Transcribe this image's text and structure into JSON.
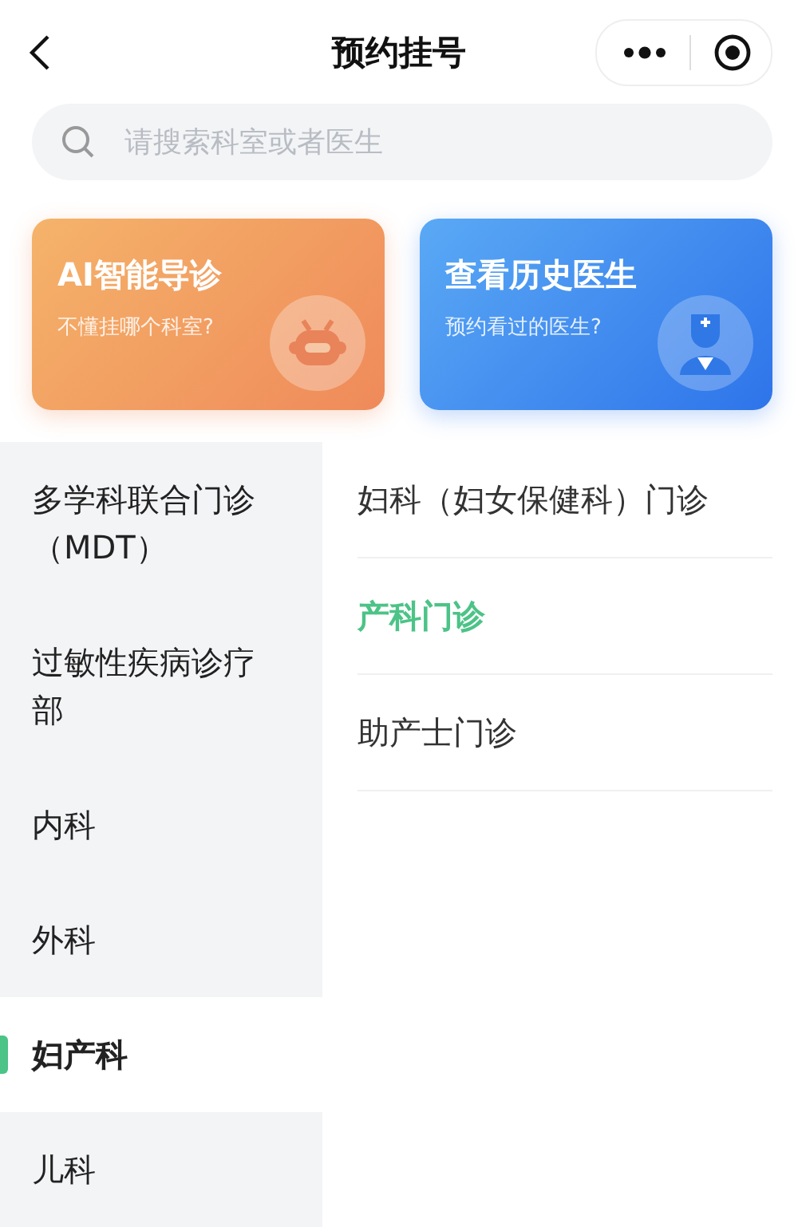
{
  "nav_bar": {
    "title": "预约挂号"
  },
  "search": {
    "placeholder": "请搜索科室或者医生"
  },
  "cards": [
    {
      "kind": "ai",
      "title": "AI智能导诊",
      "subtitle": "不懂挂哪个科室?"
    },
    {
      "kind": "history",
      "title": "查看历史医生",
      "subtitle": "预约看过的医生?"
    }
  ],
  "departments": [
    {
      "label": "多学科联合门诊（MDT）",
      "selected": false
    },
    {
      "label": "过敏性疾病诊疗部",
      "selected": false
    },
    {
      "label": "内科",
      "selected": false
    },
    {
      "label": "外科",
      "selected": false
    },
    {
      "label": "妇产科",
      "selected": true
    },
    {
      "label": "儿科",
      "selected": false
    }
  ],
  "clinics": [
    {
      "label": "妇科（妇女保健科）门诊",
      "selected": false
    },
    {
      "label": "产科门诊",
      "selected": true
    },
    {
      "label": "助产士门诊",
      "selected": false
    }
  ]
}
